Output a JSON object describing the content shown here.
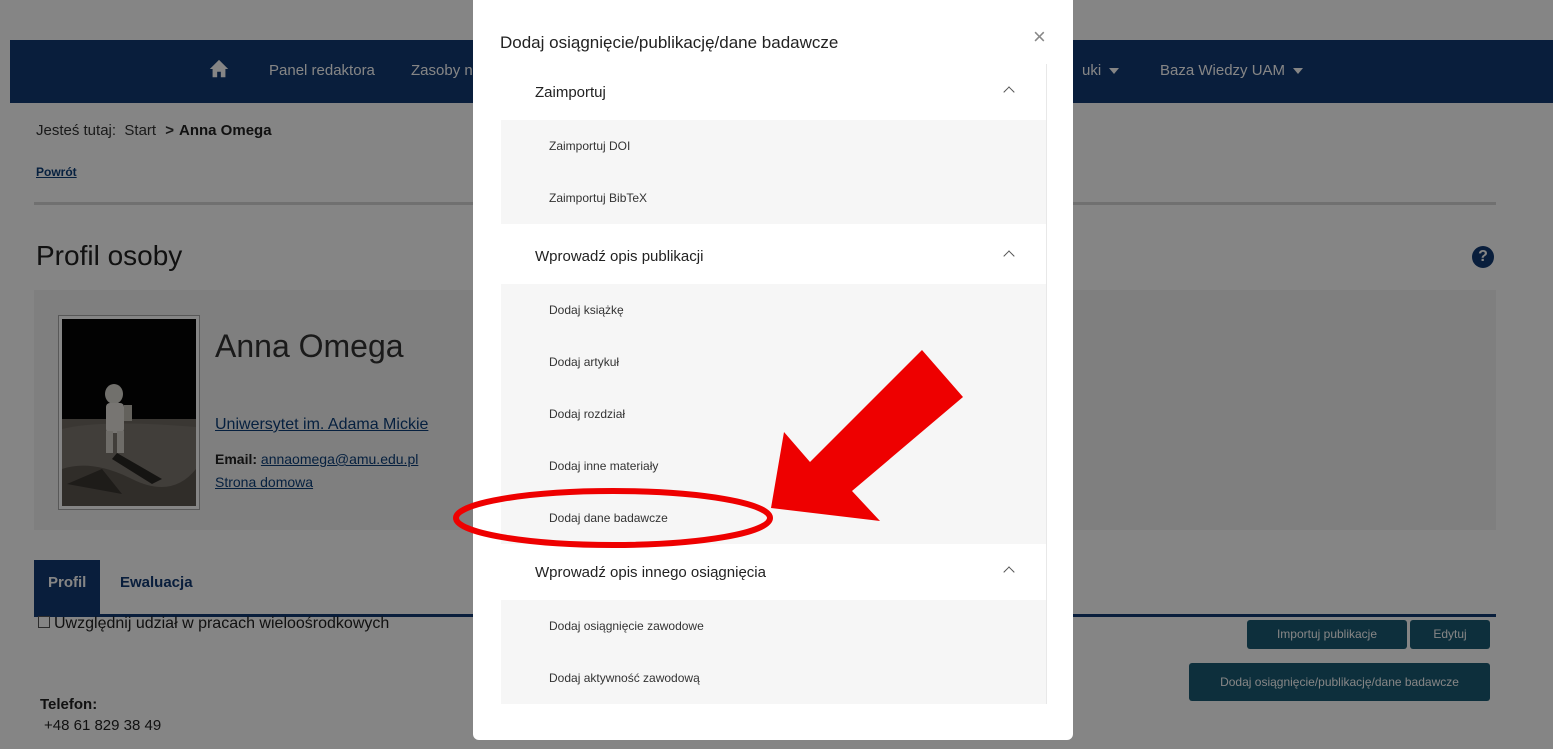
{
  "nav": {
    "items": [
      "Panel redaktora",
      "Zasoby n",
      "uki",
      "Baza Wiedzy UAM"
    ]
  },
  "breadcrumb": {
    "prefix": "Jesteś tutaj:",
    "start": "Start",
    "chevron": ">",
    "current": "Anna Omega"
  },
  "back_link": "Powrót",
  "page_title": "Profil osoby",
  "help_icon_glyph": "?",
  "profile": {
    "name": "Anna Omega",
    "university": "Uniwersytet im. Adama Mickie",
    "email_label": "Email:",
    "email": "annaomega@amu.edu.pl",
    "homepage": "Strona domowa"
  },
  "tabs": [
    {
      "label": "Profil",
      "active": true
    },
    {
      "label": "Ewaluacja",
      "active": false
    }
  ],
  "multi_checkbox_label": "Uwzględnij udział w pracach wieloośrodkowych",
  "buttons": {
    "import": "Importuj publikacje",
    "edit": "Edytuj",
    "add": "Dodaj osiągnięcie/publikację/dane badawcze"
  },
  "contact": {
    "phone_label": "Telefon:",
    "phone": "+48 61 829 38 49"
  },
  "modal": {
    "title": "Dodaj osiągnięcie/publikację/dane badawcze",
    "close_glyph": "×",
    "sections": [
      {
        "label": "Zaimportuj",
        "items": [
          "Zaimportuj DOI",
          "Zaimportuj BibTeX"
        ]
      },
      {
        "label": "Wprowadź opis publikacji",
        "items": [
          "Dodaj książkę",
          "Dodaj artykuł",
          "Dodaj rozdział",
          "Dodaj inne materiały",
          "Dodaj dane badawcze"
        ]
      },
      {
        "label": "Wprowadź opis innego osiągnięcia",
        "items": [
          "Dodaj osiągnięcie zawodowe",
          "Dodaj aktywność zawodową"
        ]
      }
    ]
  },
  "colors": {
    "nav": "#123a74",
    "button": "#1a5a73",
    "annotation": "#ee0000"
  }
}
